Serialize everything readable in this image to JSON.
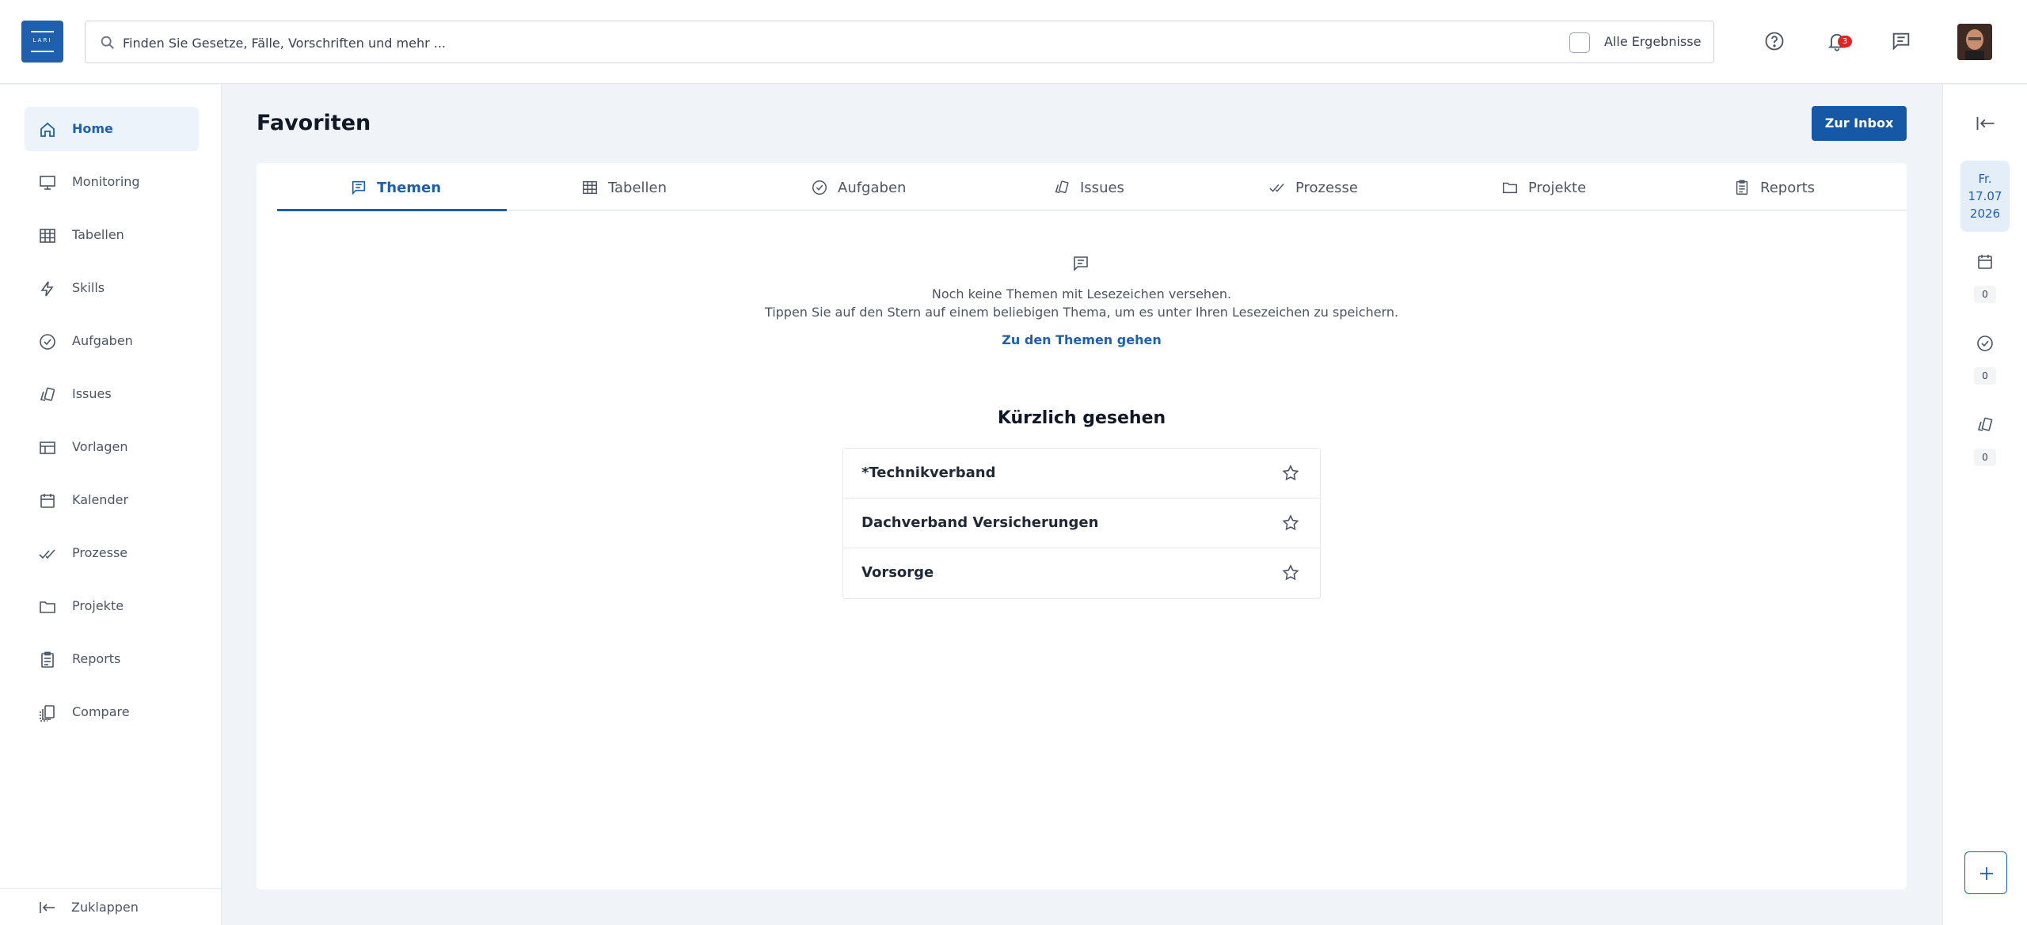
{
  "app": {
    "logo_text": "LARI"
  },
  "search": {
    "placeholder": "Finden Sie Gesetze, Fälle, Vorschriften und mehr ...",
    "checkbox_label": "Alle Ergebnisse",
    "checked": false
  },
  "header": {
    "notification_count": "3",
    "icons": [
      "help-icon",
      "bell-icon",
      "chat-icon"
    ]
  },
  "sidebar": {
    "items": [
      {
        "label": "Home",
        "icon": "home-icon",
        "active": true
      },
      {
        "label": "Monitoring",
        "icon": "monitor-icon"
      },
      {
        "label": "Tabellen",
        "icon": "table-icon"
      },
      {
        "label": "Skills",
        "icon": "bolt-icon"
      },
      {
        "label": "Aufgaben",
        "icon": "check-circle-icon"
      },
      {
        "label": "Issues",
        "icon": "issues-icon"
      },
      {
        "label": "Vorlagen",
        "icon": "template-icon"
      },
      {
        "label": "Kalender",
        "icon": "calendar-icon"
      },
      {
        "label": "Prozesse",
        "icon": "double-check-icon"
      },
      {
        "label": "Projekte",
        "icon": "folder-icon"
      },
      {
        "label": "Reports",
        "icon": "clipboard-icon"
      },
      {
        "label": "Compare",
        "icon": "compare-icon"
      }
    ],
    "collapse_label": "Zuklappen"
  },
  "main": {
    "title": "Favoriten",
    "inbox_button": "Zur Inbox",
    "tabs": [
      {
        "label": "Themen",
        "icon": "chat-icon",
        "active": true
      },
      {
        "label": "Tabellen",
        "icon": "table-icon"
      },
      {
        "label": "Aufgaben",
        "icon": "check-circle-icon"
      },
      {
        "label": "Issues",
        "icon": "issues-icon"
      },
      {
        "label": "Prozesse",
        "icon": "double-check-icon"
      },
      {
        "label": "Projekte",
        "icon": "folder-icon"
      },
      {
        "label": "Reports",
        "icon": "clipboard-icon"
      }
    ],
    "empty_state": {
      "line1": "Noch keine Themen mit Lesezeichen versehen.",
      "line2": "Tippen Sie auf den Stern auf einem beliebigen Thema, um es unter Ihren Lesezeichen zu speichern.",
      "link": "Zu den Themen gehen"
    },
    "recent": {
      "title": "Kürzlich gesehen",
      "items": [
        {
          "label": "*Technikverband"
        },
        {
          "label": "Dachverband Versicherungen"
        },
        {
          "label": "Vorsorge"
        }
      ]
    }
  },
  "right_rail": {
    "date": {
      "weekday": "Fr.",
      "day_month": "17.07",
      "year": "2026"
    },
    "counts": [
      {
        "icon": "calendar-icon",
        "count": "0"
      },
      {
        "icon": "check-circle-icon",
        "count": "0"
      },
      {
        "icon": "issues-icon",
        "count": "0"
      }
    ]
  },
  "colors": {
    "primary": "#1f5fb0",
    "button": "#1657a6",
    "badge": "#e02424",
    "background": "#f0f4f8"
  }
}
